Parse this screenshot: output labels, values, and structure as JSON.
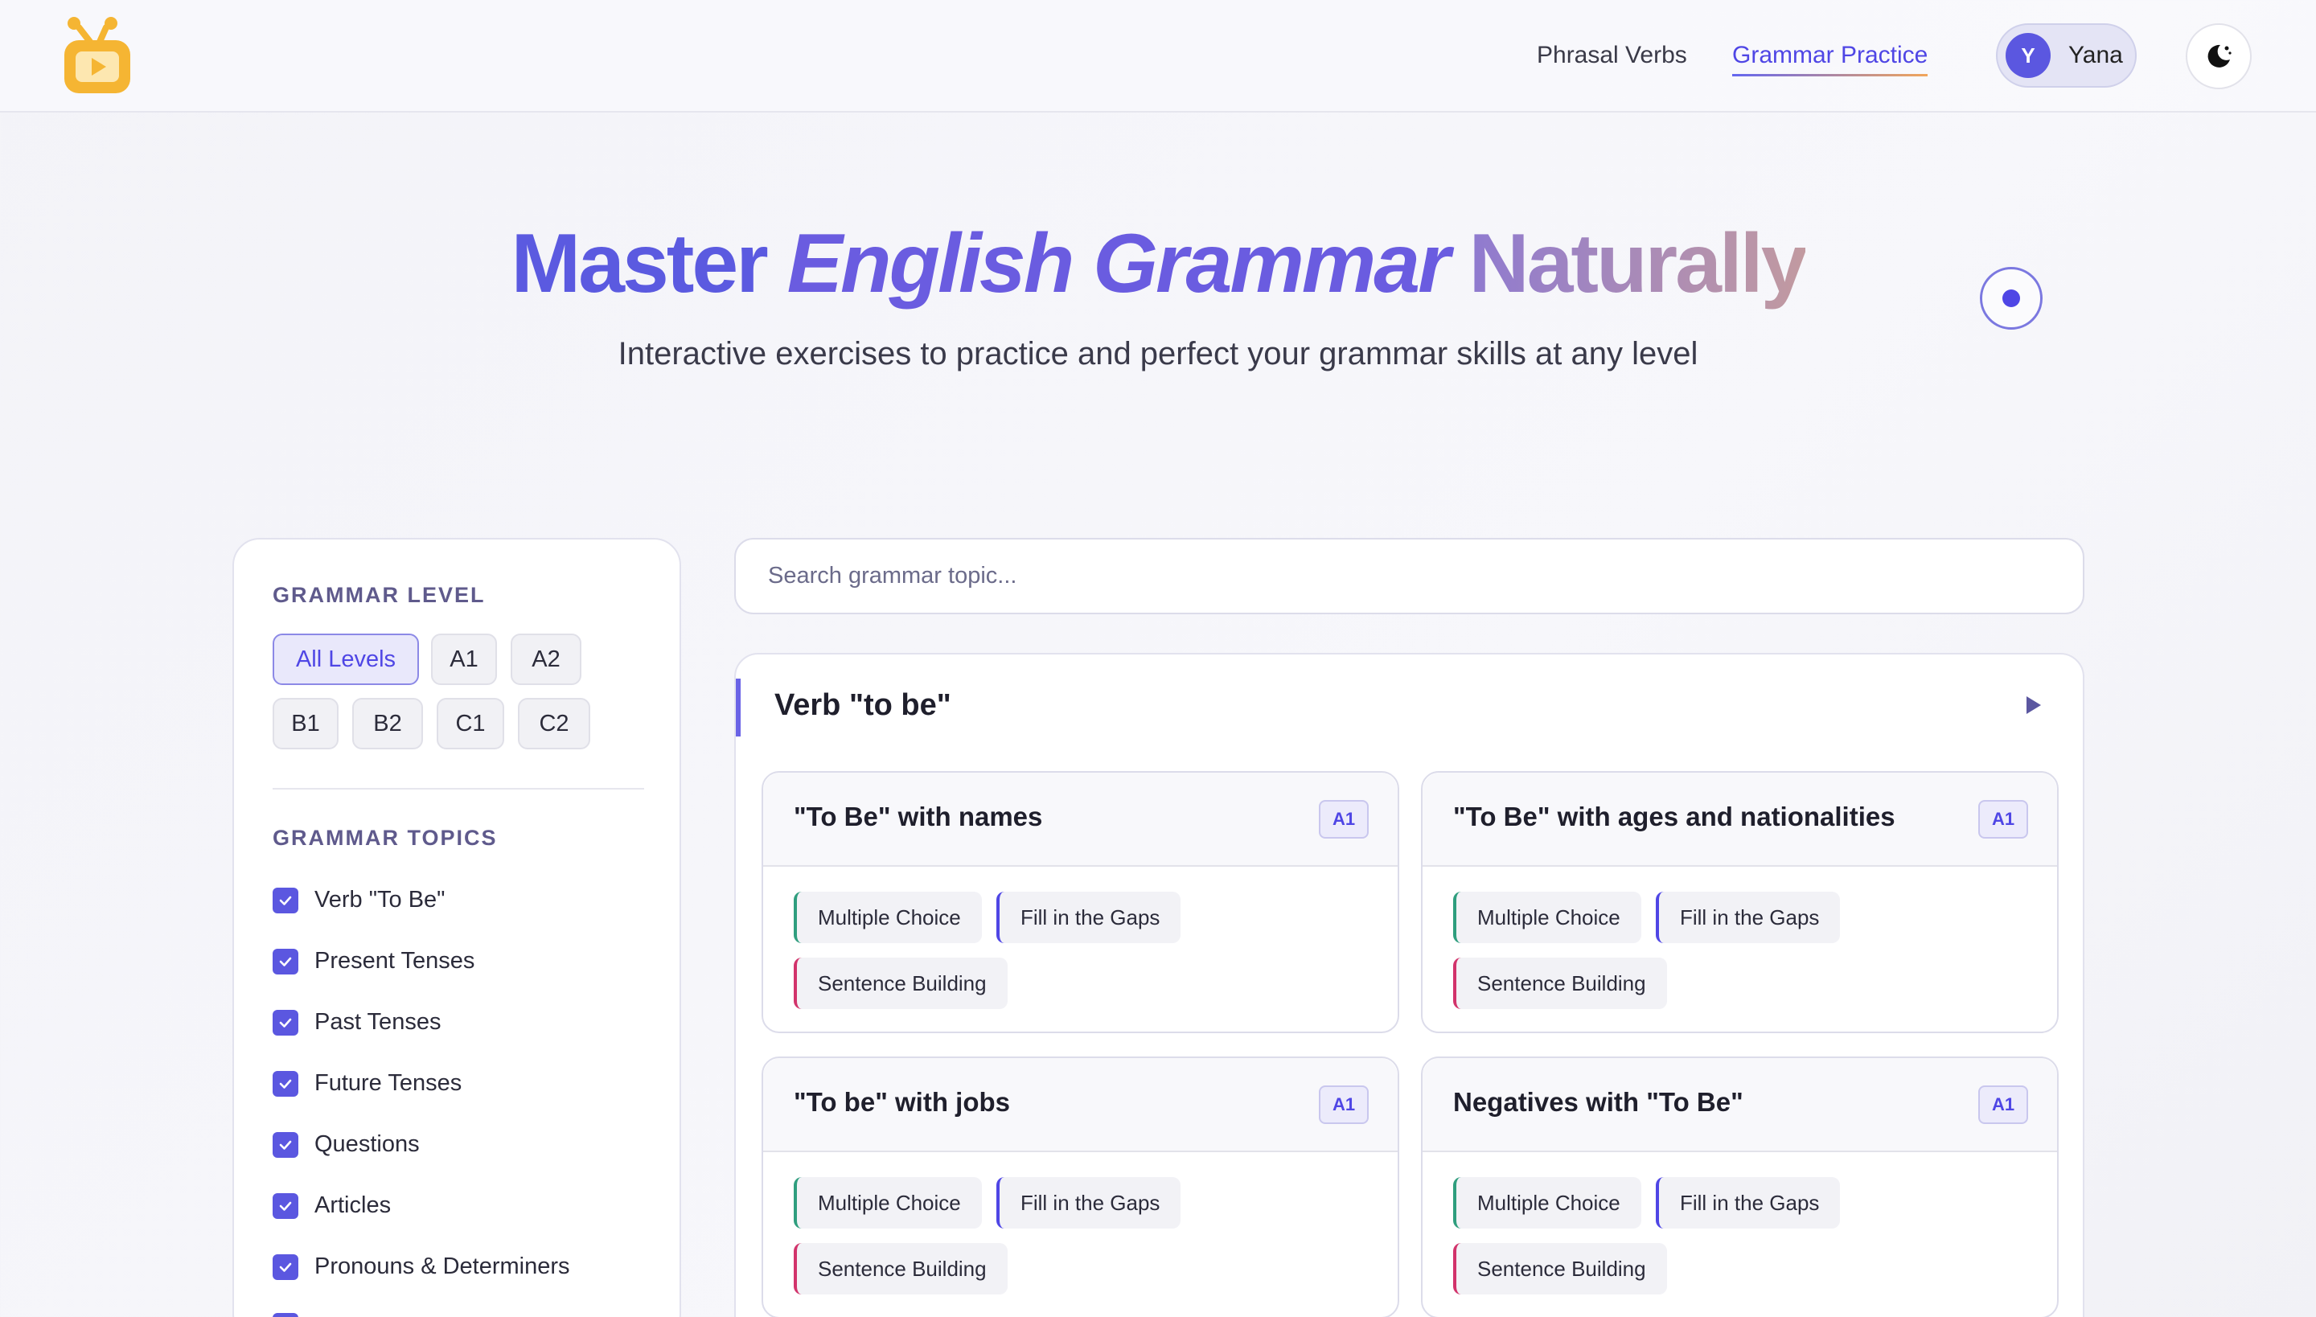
{
  "header": {
    "nav": [
      {
        "label": "Phrasal Verbs"
      },
      {
        "label": "Grammar Practice"
      }
    ],
    "user": {
      "initial": "Y",
      "name": "Yana"
    }
  },
  "hero": {
    "title_part1": "Master",
    "title_part2": "English Grammar",
    "title_part3": "Naturally",
    "subtitle": "Interactive exercises to practice and perfect your grammar skills at any level"
  },
  "sidebar": {
    "level_heading": "GRAMMAR LEVEL",
    "levels": [
      "All Levels",
      "A1",
      "A2",
      "B1",
      "B2",
      "C1",
      "C2"
    ],
    "active_level": "All Levels",
    "topics_heading": "GRAMMAR TOPICS",
    "topics": [
      "Verb \"To Be\"",
      "Present Tenses",
      "Past Tenses",
      "Future Tenses",
      "Questions",
      "Articles",
      "Pronouns & Determiners"
    ]
  },
  "search": {
    "placeholder": "Search grammar topic..."
  },
  "section": {
    "title": "Verb \"to be\"",
    "exercises": [
      {
        "title": "\"To Be\" with names",
        "level": "A1",
        "types": [
          "Multiple Choice",
          "Fill in the Gaps",
          "Sentence Building"
        ]
      },
      {
        "title": "\"To Be\" with ages and nationalities",
        "level": "A1",
        "types": [
          "Multiple Choice",
          "Fill in the Gaps",
          "Sentence Building"
        ]
      },
      {
        "title": "\"To be\" with jobs",
        "level": "A1",
        "types": [
          "Multiple Choice",
          "Fill in the Gaps",
          "Sentence Building"
        ]
      },
      {
        "title": "Negatives with \"To Be\"",
        "level": "A1",
        "types": [
          "Multiple Choice",
          "Fill in the Gaps",
          "Sentence Building"
        ]
      }
    ]
  },
  "colors": {
    "accent": "#4f46e5",
    "multiple_choice": "#2f9e7e",
    "fill_gaps": "#4f46e5",
    "sentence_building": "#d2336b"
  },
  "icons": {
    "logo": "tv-play-icon",
    "theme": "moon-icon",
    "check": "check-icon",
    "toggle": "triangle-right-icon"
  }
}
